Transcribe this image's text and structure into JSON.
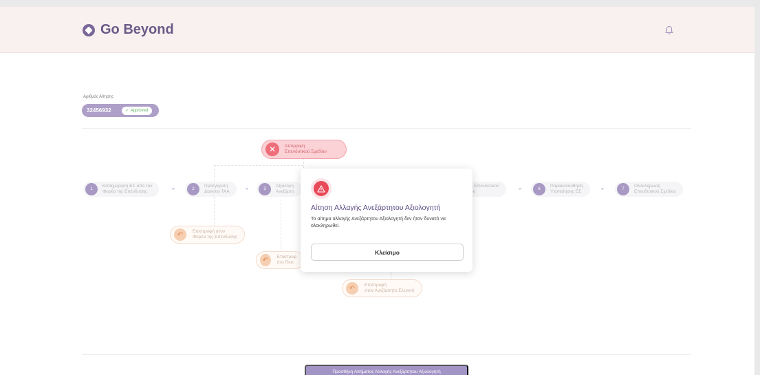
{
  "header": {
    "brand": "Go Beyond",
    "icon_bell": "bell-icon"
  },
  "request": {
    "label": "Αριθμός Αίτησης",
    "number": "32456932",
    "status": "Approved",
    "status_icon": "check-icon"
  },
  "steps": [
    {
      "num": "1",
      "line1": "Καταχώρηση ΕΣ από τον",
      "line2": "Φορέα της Επένδυσης"
    },
    {
      "num": "2",
      "line1": "Προέγκριση",
      "line2": "Δανείου ΤΑΑ"
    },
    {
      "num": "3",
      "line1": "Αξιολόγη",
      "line2": "Ανεξάρτη"
    },
    {
      "num": "",
      "line1": "η Επενδυτικού",
      "line2": "ου"
    },
    {
      "num": "6",
      "line1": "Παρακολούθηση",
      "line2": "Υλοποίησης ΕΣ"
    },
    {
      "num": "7",
      "line1": "Ολοκλήρωση",
      "line2": "Επενδυτικού Σχεδίου"
    }
  ],
  "rejection": {
    "line1": "Απόρριψη",
    "line2": "Επενδυτικού Σχεδίου",
    "icon": "close-icon"
  },
  "returns": [
    {
      "line1": "Επιστροφή στον",
      "line2": "Φορέα της Επένδυσης",
      "icon": "undo-icon"
    },
    {
      "line1": "Επιστροφ",
      "line2": "στο Πιστ",
      "icon": "undo-icon"
    },
    {
      "line1": "Επιστροφή",
      "line2": "στον Ανεξάρτητο Ελεγκτή",
      "icon": "undo-icon"
    }
  ],
  "dialog": {
    "icon": "warning-icon",
    "title": "Αίτηση Αλλαγής Ανεξάρτητου Αξιολογητή",
    "message": "Το αίτημα αλλαγής Ανεξάρτητου Αξιολογητή δεν ήταν δυνατό να ολοκληρωθεί.",
    "close_label": "Κλείσιμο"
  },
  "footer": {
    "add_button": "Προσθήκη Αιτήματος Αλλαγής Ανεξάρτητου Αξιολογητή"
  },
  "colors": {
    "brand": "#6a5a88",
    "accent": "#a899c4",
    "danger": "#e84a59",
    "success": "#5db45f"
  }
}
